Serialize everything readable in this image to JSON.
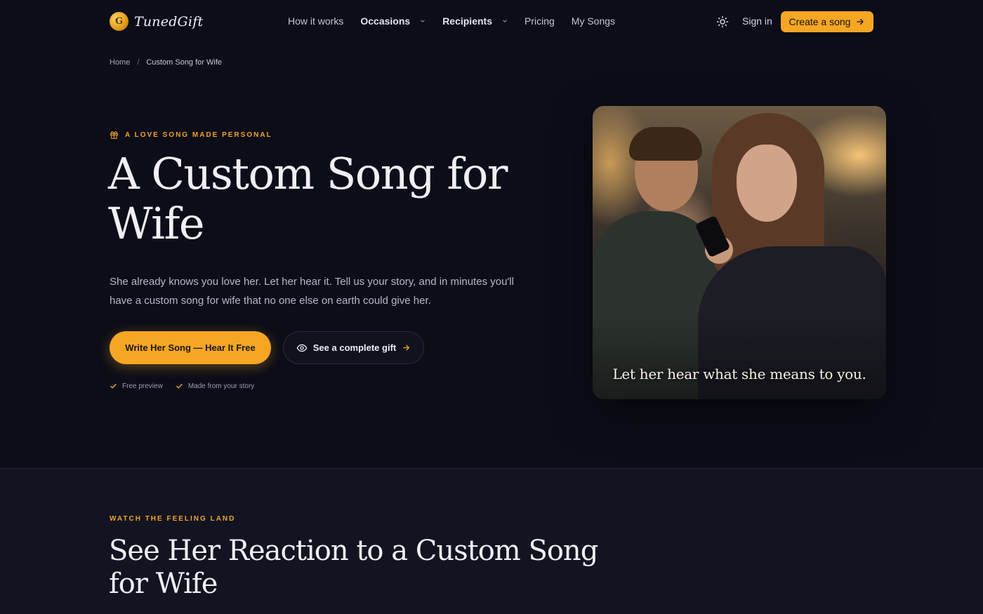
{
  "brand": {
    "name": "TunedGift",
    "mark": "G"
  },
  "nav": {
    "links": [
      "How it works",
      "Occasions",
      "Recipients",
      "Pricing",
      "My Songs"
    ],
    "sign_in": "Sign in",
    "create": "Create a song"
  },
  "breadcrumb": {
    "home": "Home",
    "separator": "/",
    "current": "Custom Song for Wife"
  },
  "hero": {
    "eyebrow": "A LOVE SONG MADE PERSONAL",
    "title": "A Custom Song for Wife",
    "subtitle": "She already knows you love her. Let her hear it. Tell us your story, and in minutes you'll have a custom song for wife that no one else on earth could give her.",
    "primary_cta": "Write Her Song — Hear It Free",
    "secondary_cta": "See a complete gift",
    "checks": [
      "Free preview",
      "Made from your story"
    ],
    "image_caption": "Let her hear what she means to you."
  },
  "section2": {
    "eyebrow": "WATCH THE FEELING LAND",
    "title": "See Her Reaction to a Custom Song for Wife"
  },
  "colors": {
    "accent": "#f5a623",
    "background": "#0c0d18",
    "section_bg": "#131422"
  }
}
